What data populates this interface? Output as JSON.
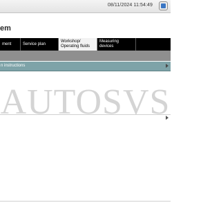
{
  "header": {
    "datetime": "08/11/2024  11:54:49"
  },
  "page": {
    "title": "em"
  },
  "tabs": [
    {
      "label": "ment"
    },
    {
      "label": "Service plan"
    },
    {
      "label": "Workshop/\nOperating fluids",
      "active": true
    },
    {
      "label": "Measuring devices"
    }
  ],
  "list": {
    "row_label": "n instructions"
  },
  "watermark": {
    "text": "AUTOSVS"
  },
  "colors": {
    "tab_bar": "#000000",
    "row_highlight": "#7ea3a8",
    "band": "#8f8f8f"
  }
}
